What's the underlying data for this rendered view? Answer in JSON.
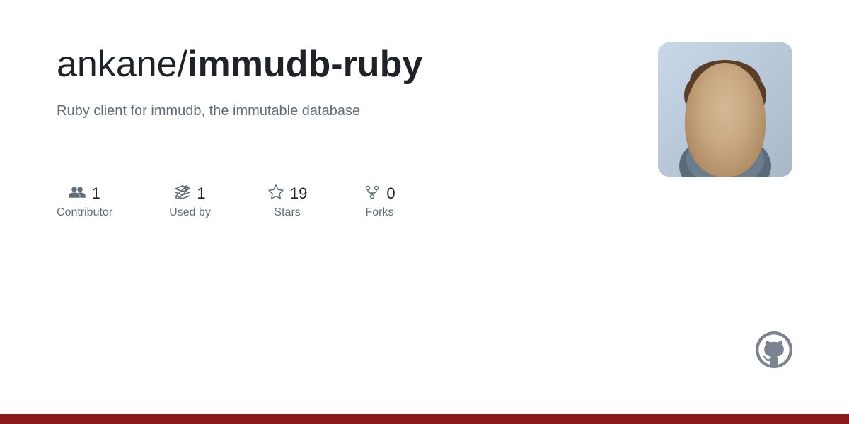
{
  "repo": {
    "owner": "ankane/",
    "name": "immudb-ruby",
    "description": "Ruby client for immudb, the immutable database"
  },
  "stats": [
    {
      "id": "contributors",
      "icon": "people-icon",
      "value": "1",
      "label": "Contributor"
    },
    {
      "id": "used-by",
      "icon": "package-icon",
      "value": "1",
      "label": "Used by"
    },
    {
      "id": "stars",
      "icon": "star-icon",
      "value": "19",
      "label": "Stars"
    },
    {
      "id": "forks",
      "icon": "fork-icon",
      "value": "0",
      "label": "Forks"
    }
  ],
  "colors": {
    "bottom_bar": "#8b1a1a",
    "title_color": "#1f2328",
    "description_color": "#636c76",
    "stats_color": "#636c76"
  }
}
